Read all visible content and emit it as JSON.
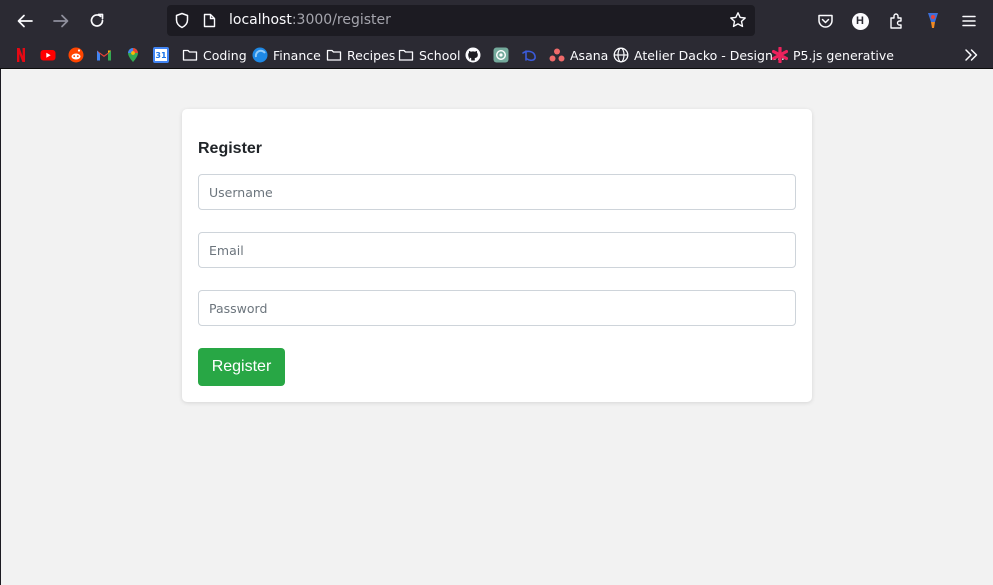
{
  "browser": {
    "url_host": "localhost",
    "url_path": ":3000/register",
    "profile_initial": "H"
  },
  "bookmarks": [
    {
      "icon": "netflix-icon",
      "label": ""
    },
    {
      "icon": "youtube-icon",
      "label": ""
    },
    {
      "icon": "reddit-icon",
      "label": ""
    },
    {
      "icon": "gmail-icon",
      "label": ""
    },
    {
      "icon": "maps-icon",
      "label": ""
    },
    {
      "icon": "calendar-icon",
      "label": "31"
    },
    {
      "icon": "folder-icon",
      "label": "Coding"
    },
    {
      "icon": "finance-icon",
      "label": "Finance"
    },
    {
      "icon": "folder-icon",
      "label": "Recipes"
    },
    {
      "icon": "folder-icon",
      "label": "School"
    },
    {
      "icon": "github-icon",
      "label": ""
    },
    {
      "icon": "chatgpt-icon",
      "label": ""
    },
    {
      "icon": "disney-icon",
      "label": ""
    },
    {
      "icon": "asana-icon",
      "label": "Asana"
    },
    {
      "icon": "globe-icon",
      "label": "Atelier Dacko - Design..."
    },
    {
      "icon": "p5js-icon",
      "label": "P5.js generative"
    }
  ],
  "form": {
    "title": "Register",
    "username_placeholder": "Username",
    "email_placeholder": "Email",
    "password_placeholder": "Password",
    "submit_label": "Register"
  },
  "colors": {
    "accent": "#28a745",
    "page_background": "#f2f2f2",
    "browser_chrome": "#2b2a33"
  }
}
